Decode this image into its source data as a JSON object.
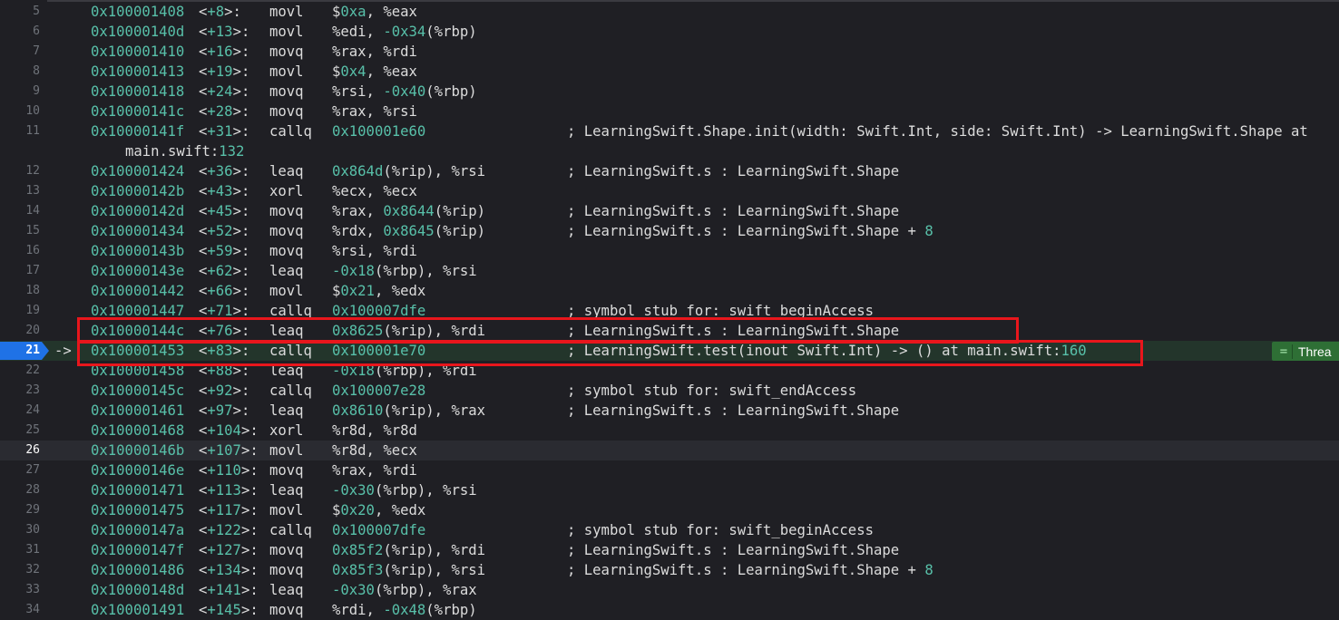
{
  "lines": [
    {
      "n": "5",
      "addr": "0x100001408",
      "offset": "+8",
      "op": "movl",
      "args": [
        {
          "t": "$"
        },
        {
          "t": "0xa",
          "n": true
        },
        {
          "t": ", %eax"
        }
      ]
    },
    {
      "n": "6",
      "addr": "0x10000140d",
      "offset": "+13",
      "op": "movl",
      "args": [
        {
          "t": "%edi, "
        },
        {
          "t": "-0x34",
          "n": true
        },
        {
          "t": "(%rbp)"
        }
      ]
    },
    {
      "n": "7",
      "addr": "0x100001410",
      "offset": "+16",
      "op": "movq",
      "args": [
        {
          "t": "%rax, %rdi"
        }
      ]
    },
    {
      "n": "8",
      "addr": "0x100001413",
      "offset": "+19",
      "op": "movl",
      "args": [
        {
          "t": "$"
        },
        {
          "t": "0x4",
          "n": true
        },
        {
          "t": ", %eax"
        }
      ]
    },
    {
      "n": "9",
      "addr": "0x100001418",
      "offset": "+24",
      "op": "movq",
      "args": [
        {
          "t": "%rsi, "
        },
        {
          "t": "-0x40",
          "n": true
        },
        {
          "t": "(%rbp)"
        }
      ]
    },
    {
      "n": "10",
      "addr": "0x10000141c",
      "offset": "+28",
      "op": "movq",
      "args": [
        {
          "t": "%rax, %rsi"
        }
      ]
    },
    {
      "n": "11",
      "addr": "0x10000141f",
      "offset": "+31",
      "op": "callq",
      "args": [
        {
          "t": "0x100001e60",
          "n": true
        }
      ],
      "comment": [
        {
          "t": "; LearningSwift.Shape.init(width: Swift.Int, side: Swift.Int) -> LearningSwift.Shape at"
        }
      ],
      "cont": [
        {
          "t": "main.swift:"
        },
        {
          "t": "132",
          "n": true
        }
      ]
    },
    {
      "n": "12",
      "addr": "0x100001424",
      "offset": "+36",
      "op": "leaq",
      "args": [
        {
          "t": "0x864d",
          "n": true
        },
        {
          "t": "(%rip), %rsi"
        }
      ],
      "comment": [
        {
          "t": "; LearningSwift.s : LearningSwift.Shape"
        }
      ]
    },
    {
      "n": "13",
      "addr": "0x10000142b",
      "offset": "+43",
      "op": "xorl",
      "args": [
        {
          "t": "%ecx, %ecx"
        }
      ]
    },
    {
      "n": "14",
      "addr": "0x10000142d",
      "offset": "+45",
      "op": "movq",
      "args": [
        {
          "t": "%rax, "
        },
        {
          "t": "0x8644",
          "n": true
        },
        {
          "t": "(%rip)"
        }
      ],
      "comment": [
        {
          "t": "; LearningSwift.s : LearningSwift.Shape"
        }
      ]
    },
    {
      "n": "15",
      "addr": "0x100001434",
      "offset": "+52",
      "op": "movq",
      "args": [
        {
          "t": "%rdx, "
        },
        {
          "t": "0x8645",
          "n": true
        },
        {
          "t": "(%rip)"
        }
      ],
      "comment": [
        {
          "t": "; LearningSwift.s : LearningSwift.Shape + "
        },
        {
          "t": "8",
          "n": true
        }
      ]
    },
    {
      "n": "16",
      "addr": "0x10000143b",
      "offset": "+59",
      "op": "movq",
      "args": [
        {
          "t": "%rsi, %rdi"
        }
      ]
    },
    {
      "n": "17",
      "addr": "0x10000143e",
      "offset": "+62",
      "op": "leaq",
      "args": [
        {
          "t": "-0x18",
          "n": true
        },
        {
          "t": "(%rbp), %rsi"
        }
      ]
    },
    {
      "n": "18",
      "addr": "0x100001442",
      "offset": "+66",
      "op": "movl",
      "args": [
        {
          "t": "$"
        },
        {
          "t": "0x21",
          "n": true
        },
        {
          "t": ", %edx"
        }
      ]
    },
    {
      "n": "19",
      "addr": "0x100001447",
      "offset": "+71",
      "op": "callq",
      "args": [
        {
          "t": "0x100007dfe",
          "n": true
        }
      ],
      "comment": [
        {
          "t": "; symbol stub for: swift_beginAccess"
        }
      ]
    },
    {
      "n": "20",
      "addr": "0x10000144c",
      "offset": "+76",
      "op": "leaq",
      "args": [
        {
          "t": "0x8625",
          "n": true
        },
        {
          "t": "(%rip), %rdi"
        }
      ],
      "comment": [
        {
          "t": "; LearningSwift.s : LearningSwift.Shape"
        }
      ]
    },
    {
      "n": "21",
      "addr": "0x100001453",
      "offset": "+83",
      "op": "callq",
      "args": [
        {
          "t": "0x100001e70",
          "n": true
        }
      ],
      "comment": [
        {
          "t": "; LearningSwift.test(inout Swift.Int) -> () at main.swift:"
        },
        {
          "t": "160",
          "n": true
        }
      ],
      "pc": true
    },
    {
      "n": "22",
      "addr": "0x100001458",
      "offset": "+88",
      "op": "leaq",
      "args": [
        {
          "t": "-0x18",
          "n": true
        },
        {
          "t": "(%rbp), %rdi"
        }
      ]
    },
    {
      "n": "23",
      "addr": "0x10000145c",
      "offset": "+92",
      "op": "callq",
      "args": [
        {
          "t": "0x100007e28",
          "n": true
        }
      ],
      "comment": [
        {
          "t": "; symbol stub for: swift_endAccess"
        }
      ]
    },
    {
      "n": "24",
      "addr": "0x100001461",
      "offset": "+97",
      "op": "leaq",
      "args": [
        {
          "t": "0x8610",
          "n": true
        },
        {
          "t": "(%rip), %rax"
        }
      ],
      "comment": [
        {
          "t": "; LearningSwift.s : LearningSwift.Shape"
        }
      ]
    },
    {
      "n": "25",
      "addr": "0x100001468",
      "offset": "+104",
      "op": "xorl",
      "args": [
        {
          "t": "%r8d, %r8d"
        }
      ]
    },
    {
      "n": "26",
      "addr": "0x10000146b",
      "offset": "+107",
      "op": "movl",
      "args": [
        {
          "t": "%r8d, %ecx"
        }
      ],
      "current": true
    },
    {
      "n": "27",
      "addr": "0x10000146e",
      "offset": "+110",
      "op": "movq",
      "args": [
        {
          "t": "%rax, %rdi"
        }
      ]
    },
    {
      "n": "28",
      "addr": "0x100001471",
      "offset": "+113",
      "op": "leaq",
      "args": [
        {
          "t": "-0x30",
          "n": true
        },
        {
          "t": "(%rbp), %rsi"
        }
      ]
    },
    {
      "n": "29",
      "addr": "0x100001475",
      "offset": "+117",
      "op": "movl",
      "args": [
        {
          "t": "$"
        },
        {
          "t": "0x20",
          "n": true
        },
        {
          "t": ", %edx"
        }
      ]
    },
    {
      "n": "30",
      "addr": "0x10000147a",
      "offset": "+122",
      "op": "callq",
      "args": [
        {
          "t": "0x100007dfe",
          "n": true
        }
      ],
      "comment": [
        {
          "t": "; symbol stub for: swift_beginAccess"
        }
      ]
    },
    {
      "n": "31",
      "addr": "0x10000147f",
      "offset": "+127",
      "op": "movq",
      "args": [
        {
          "t": "0x85f2",
          "n": true
        },
        {
          "t": "(%rip), %rdi"
        }
      ],
      "comment": [
        {
          "t": "; LearningSwift.s : LearningSwift.Shape"
        }
      ]
    },
    {
      "n": "32",
      "addr": "0x100001486",
      "offset": "+134",
      "op": "movq",
      "args": [
        {
          "t": "0x85f3",
          "n": true
        },
        {
          "t": "(%rip), %rsi"
        }
      ],
      "comment": [
        {
          "t": "; LearningSwift.s : LearningSwift.Shape + "
        },
        {
          "t": "8",
          "n": true
        }
      ]
    },
    {
      "n": "33",
      "addr": "0x10000148d",
      "offset": "+141",
      "op": "leaq",
      "args": [
        {
          "t": "-0x30",
          "n": true
        },
        {
          "t": "(%rbp), %rax"
        }
      ]
    },
    {
      "n": "34",
      "addr": "0x100001491",
      "offset": "+145",
      "op": "movq",
      "args": [
        {
          "t": "%rdi, "
        },
        {
          "t": "-0x48",
          "n": true
        },
        {
          "t": "(%rbp)"
        }
      ]
    }
  ],
  "pc_arrow": "->",
  "thread_badge": {
    "icon": "equals-icon",
    "icon_glyph": "=",
    "label": "Threa"
  },
  "colors": {
    "background": "#1f1f24",
    "number": "#58c0a9",
    "pc_line": "#23352b",
    "pc_marker": "#1f72e6",
    "annotation_box": "#e8161c",
    "thread_badge": "#2e6f35"
  }
}
